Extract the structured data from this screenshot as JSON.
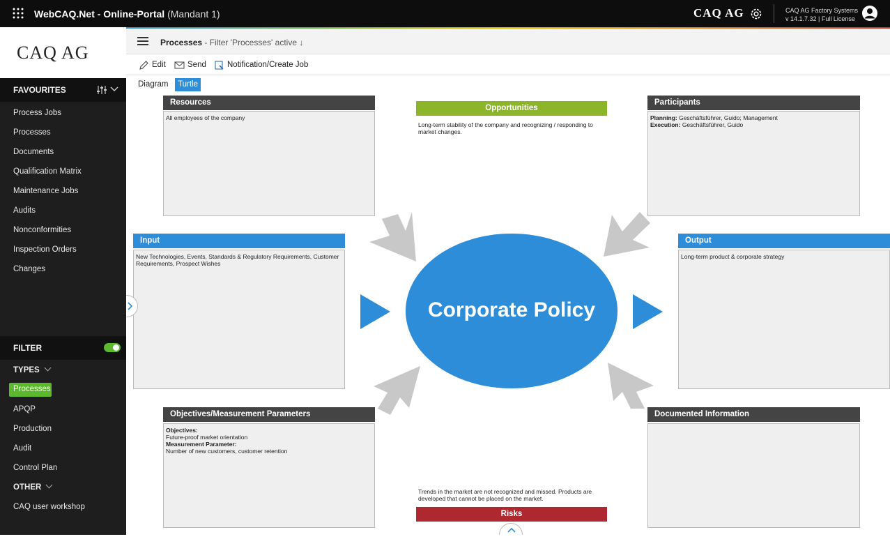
{
  "topbar": {
    "app_title": "WebCAQ.Net - Online-Portal",
    "mandant": "(Mandant 1)",
    "logo": "CAQ AG",
    "company_name": "CAQ AG Factory Systems",
    "version": "v 14.1.7.32 | Full License"
  },
  "sidebar": {
    "logo": "CAQ AG",
    "favourites_label": "FAVOURITES",
    "favourites": [
      "Process Jobs",
      "Processes",
      "Documents",
      "Qualification Matrix",
      "Maintenance Jobs",
      "Audits",
      "Nonconformities",
      "Inspection Orders",
      "Changes"
    ],
    "filter_label": "FILTER",
    "filter_active": true,
    "types_label": "TYPES",
    "types": [
      "Processes",
      "APQP",
      "Production",
      "Audit",
      "Control Plan"
    ],
    "selected_type": "Processes",
    "other_label": "OTHER",
    "other": [
      "CAQ user workshop"
    ]
  },
  "header": {
    "title": "Processes",
    "subtitle": " - Filter 'Processes' active ↓"
  },
  "toolbar": {
    "edit_label": "Edit",
    "send_label": "Send",
    "notify_label": "Notification/Create Job"
  },
  "tabs": [
    {
      "label": "Diagram",
      "active": false
    },
    {
      "label": "Turtle",
      "active": true
    }
  ],
  "turtle": {
    "center": "Corporate Policy",
    "resources": {
      "title": "Resources",
      "text": "All employees of the company"
    },
    "opportunities": {
      "title": "Opportunities",
      "text": "Long-term stability of the company and recognizing / responding to market changes."
    },
    "participants": {
      "title": "Participants",
      "planning_label": "Planning:",
      "planning_text": " Geschäftsführer, Guido; Management",
      "execution_label": "Execution:",
      "execution_text": " Geschäftsführer, Guido"
    },
    "input": {
      "title": "Input",
      "text": "New Technologies, Events, Standards & Regulatory Requirements, Customer Requirements, Prospect Wishes"
    },
    "output": {
      "title": "Output",
      "text": "Long-term product & corporate strategy"
    },
    "objectives": {
      "title": "Objectives/Measurement Parameters",
      "objectives_label": "Objectives:",
      "objectives_text": "Future-proof market orientation",
      "measurement_label": "Measurement Parameter:",
      "measurement_text": "Number of new customers, customer retention"
    },
    "documented": {
      "title": "Documented Information",
      "text": ""
    },
    "risks": {
      "title": "Risks",
      "text": "Trends in the market are not recognized and missed. Products are developed that cannot be placed on the market."
    }
  },
  "colors": {
    "accent_blue": "#2d8dd8",
    "green": "#5cb82d",
    "opportunities_green": "#8db52a",
    "risks_red": "#b0282f",
    "header_dark": "#444444"
  }
}
